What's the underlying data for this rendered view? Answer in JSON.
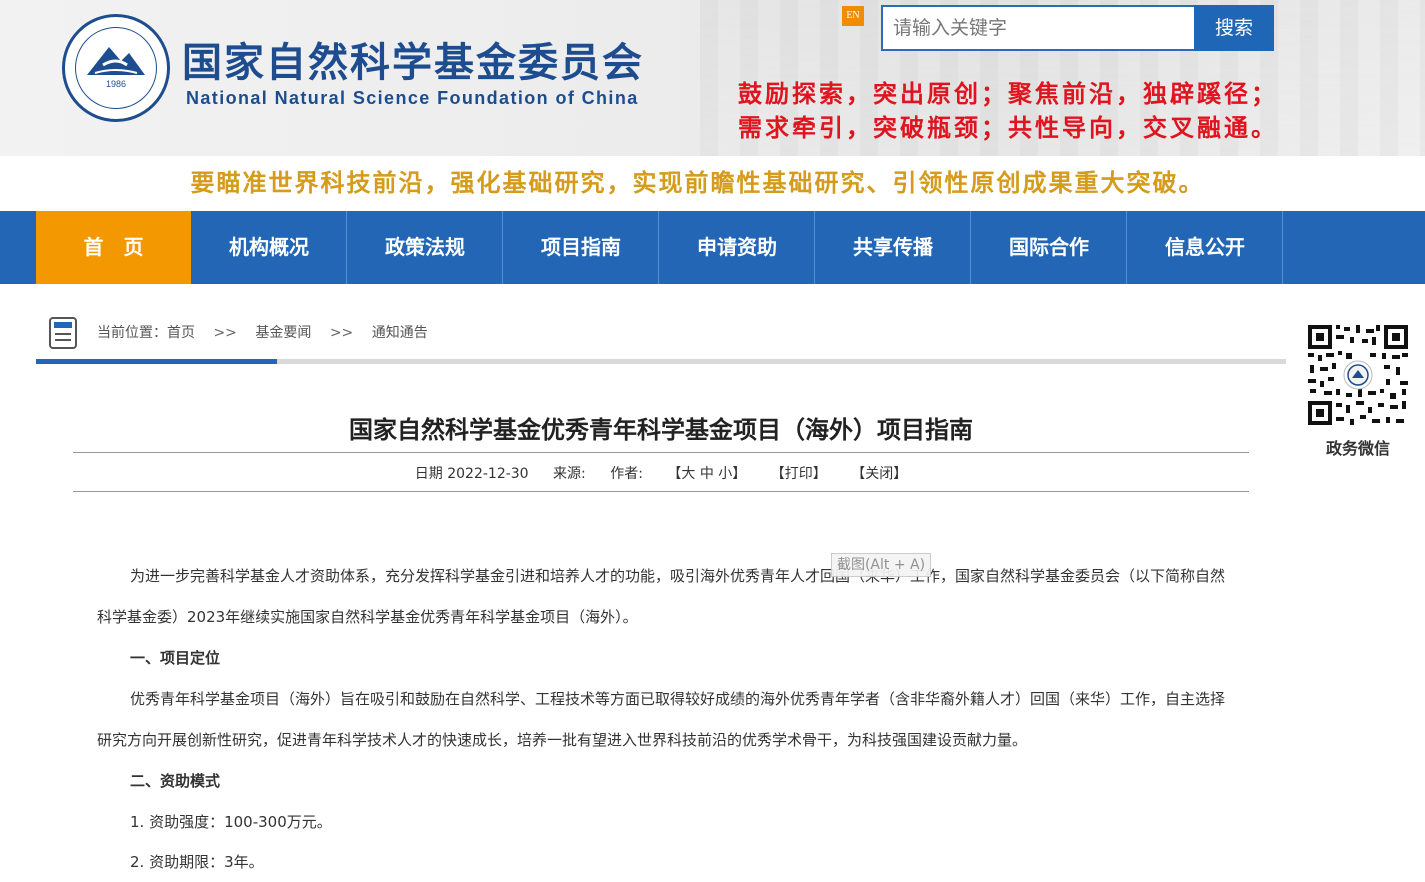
{
  "header": {
    "org_name_cn": "国家自然科学基金委员会",
    "org_name_en": "National Natural Science Foundation of China",
    "logo_year": "1986",
    "lang_switch": "EN",
    "search_placeholder": "请输入关键字",
    "search_button": "搜索",
    "motto_line1": "鼓励探索，突出原创；聚焦前沿，独辟蹊径；",
    "motto_line2": "需求牵引，突破瓶颈；共性导向，交叉融通。"
  },
  "slogan": "要瞄准世界科技前沿，强化基础研究，实现前瞻性基础研究、引领性原创成果重大突破。",
  "nav": {
    "items": [
      {
        "label": "首　页"
      },
      {
        "label": "机构概况"
      },
      {
        "label": "政策法规"
      },
      {
        "label": "项目指南"
      },
      {
        "label": "申请资助"
      },
      {
        "label": "共享传播"
      },
      {
        "label": "国际合作"
      },
      {
        "label": "信息公开"
      }
    ]
  },
  "breadcrumb": {
    "prefix": "当前位置：",
    "items": [
      "首页",
      "基金要闻",
      "通知通告"
    ],
    "separator": ">>"
  },
  "qr": {
    "label": "政务微信"
  },
  "article": {
    "title": "国家自然科学基金优秀青年科学基金项目（海外）项目指南",
    "date": "日期 2022-12-30",
    "source": "来源:",
    "author": "作者:",
    "font_size": "【大 中 小】",
    "print": "【打印】",
    "close": "【关闭】",
    "paragraphs": {
      "p1": "为进一步完善科学基金人才资助体系，充分发挥科学基金引进和培养人才的功能，吸引海外优秀青年人才回国（来华）工作，国家自然科学基金委员会（以下简称自然科学基金委）2023年继续实施国家自然科学基金优秀青年科学基金项目（海外）。",
      "h1": "一、项目定位",
      "p2": "优秀青年科学基金项目（海外）旨在吸引和鼓励在自然科学、工程技术等方面已取得较好成绩的海外优秀青年学者（含非华裔外籍人才）回国（来华）工作，自主选择研究方向开展创新性研究，促进青年科学技术人才的快速成长，培养一批有望进入世界科技前沿的优秀学术骨干，为科技强国建设贡献力量。",
      "h2": "二、资助模式",
      "l1": "1. 资助强度：100-300万元。",
      "l2": "2. 资助期限：3年。"
    }
  },
  "tooltip": "截图(Alt + A)",
  "colors": {
    "brand_blue": "#2266b5",
    "nav_active": "#f39800",
    "motto_red": "#e0141e",
    "slogan_gold": "#d59b1c"
  }
}
